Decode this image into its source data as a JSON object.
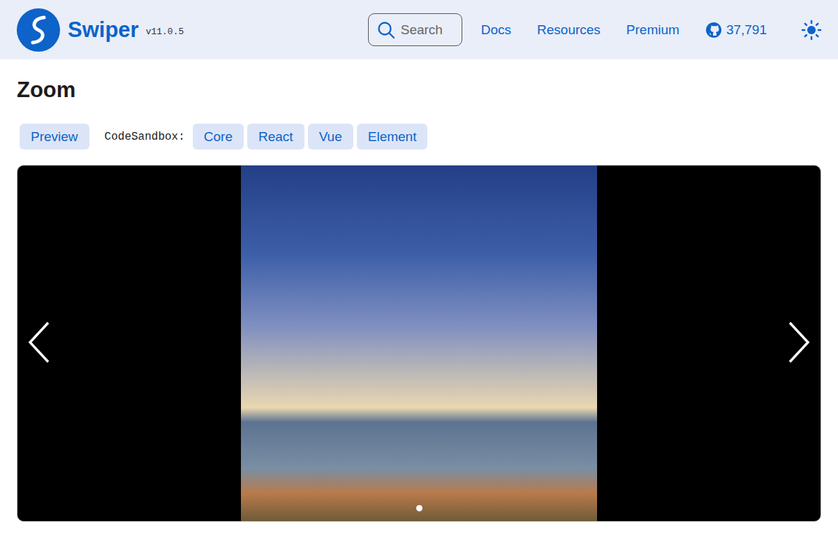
{
  "header": {
    "brand": "Swiper",
    "version": "v11.0.5",
    "search": {
      "label": "Search"
    },
    "nav": [
      {
        "label": "Docs"
      },
      {
        "label": "Resources"
      },
      {
        "label": "Premium"
      }
    ],
    "github": {
      "stars": "37,791"
    }
  },
  "page": {
    "title": "Zoom"
  },
  "demo_links": {
    "preview": "Preview",
    "codesandbox_label": "CodeSandbox:",
    "items": [
      "Core",
      "React",
      "Vue",
      "Element"
    ]
  },
  "slider": {
    "pagination": [
      {
        "selected": true
      }
    ]
  }
}
